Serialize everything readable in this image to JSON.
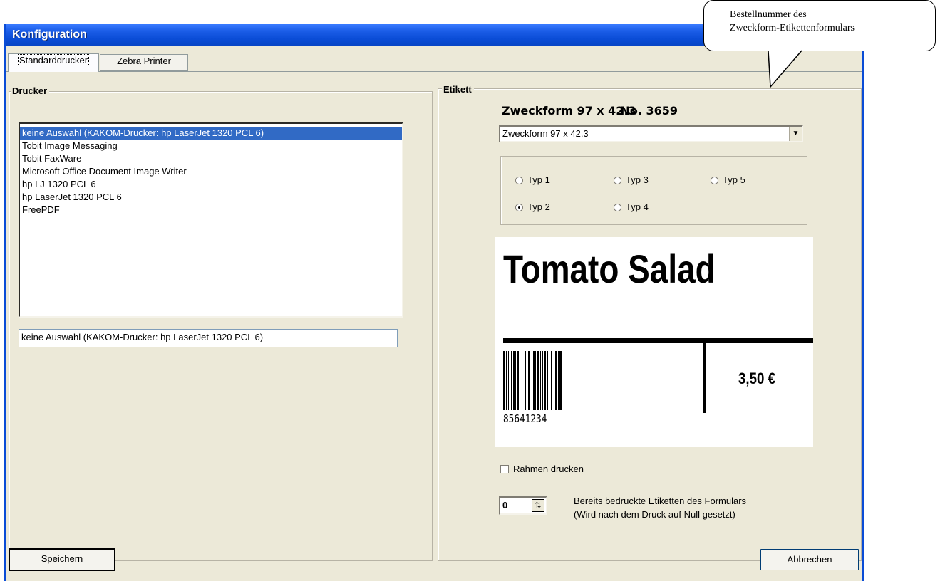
{
  "window": {
    "title": "Konfiguration"
  },
  "tabs": [
    {
      "label": "Standarddrucker",
      "active": true
    },
    {
      "label": "Zebra Printer",
      "active": false
    }
  ],
  "printer_group": {
    "label": "Drucker",
    "list": [
      {
        "label": "keine Auswahl (KAKOM-Drucker: hp LaserJet 1320 PCL 6)",
        "selected": true
      },
      {
        "label": "Tobit Image Messaging"
      },
      {
        "label": "Tobit FaxWare"
      },
      {
        "label": "Microsoft Office Document Image Writer"
      },
      {
        "label": "hp LJ 1320 PCL 6"
      },
      {
        "label": "hp LaserJet 1320 PCL 6"
      },
      {
        "label": "FreePDF"
      }
    ],
    "selected_value": "keine Auswahl (KAKOM-Drucker: hp LaserJet 1320 PCL 6)"
  },
  "label_group": {
    "label": "Etikett",
    "format_name": "Zweckform 97 x 42.3",
    "order_number": "No. 3659",
    "format_select": "Zweckform 97 x 42.3",
    "types": [
      {
        "label": "Typ 1",
        "checked": false
      },
      {
        "label": "Typ 2",
        "checked": true
      },
      {
        "label": "Typ 3",
        "checked": false
      },
      {
        "label": "Typ 4",
        "checked": false
      },
      {
        "label": "Typ 5",
        "checked": false
      }
    ],
    "preview": {
      "title": "Tomato Salad",
      "price": "3,50 €",
      "barcode_number": "85641234"
    },
    "print_frame_label": "Rahmen drucken",
    "print_frame_checked": false,
    "printed_count": "0",
    "printed_count_label_line1": "Bereits bedruckte Etiketten des Formulars",
    "printed_count_label_line2": "(Wird nach dem Druck auf Null gesetzt)"
  },
  "buttons": {
    "save": "Speichern",
    "cancel": "Abbrechen"
  },
  "callout": {
    "line1": "Bestellnummer des",
    "line2": "Zweckform-Etikettenformulars"
  },
  "colors": {
    "title_bar": "#0a4cd6",
    "dialog_bg": "#ece9d8",
    "selection": "#316ac5"
  }
}
